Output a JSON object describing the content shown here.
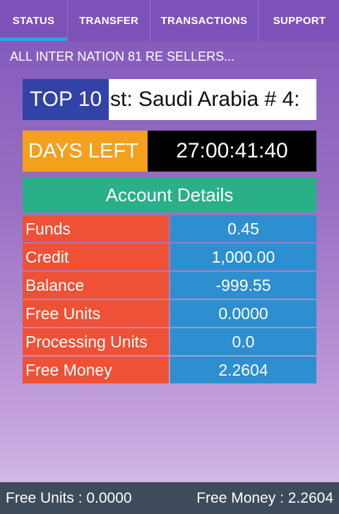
{
  "tabs": [
    {
      "label": "STATUS",
      "active": true
    },
    {
      "label": "TRANSFER",
      "active": false
    },
    {
      "label": "TRANSACTIONS",
      "active": false
    },
    {
      "label": "SUPPORT",
      "active": false
    }
  ],
  "marquee": "ALL  INTER NATION 81 RE SELLERS...",
  "top10": {
    "label": "TOP 10",
    "scroll_text": "st: Saudi Arabia # 4:"
  },
  "days_left": {
    "label": "DAYS LEFT",
    "value": "27:00:41:40"
  },
  "account_details": {
    "title": "Account Details",
    "rows": [
      {
        "label": "Funds",
        "value": "0.45"
      },
      {
        "label": "Credit",
        "value": "1,000.00"
      },
      {
        "label": "Balance",
        "value": "-999.55"
      },
      {
        "label": "Free Units",
        "value": "0.0000"
      },
      {
        "label": "Processing Units",
        "value": "0.0"
      },
      {
        "label": "Free Money",
        "value": "2.2604"
      }
    ]
  },
  "footer": {
    "free_units": "Free Units : 0.0000",
    "free_money": "Free Money : 2.2604"
  },
  "colors": {
    "tab_bar": "#7d52b8",
    "tab_indicator": "#2ea3e3",
    "top10_label": "#3242a6",
    "days_label": "#f4a01c",
    "account_header": "#29b089",
    "row_label": "#ef5136",
    "row_value": "#2d8fd0",
    "footer": "#3f4a5c"
  }
}
